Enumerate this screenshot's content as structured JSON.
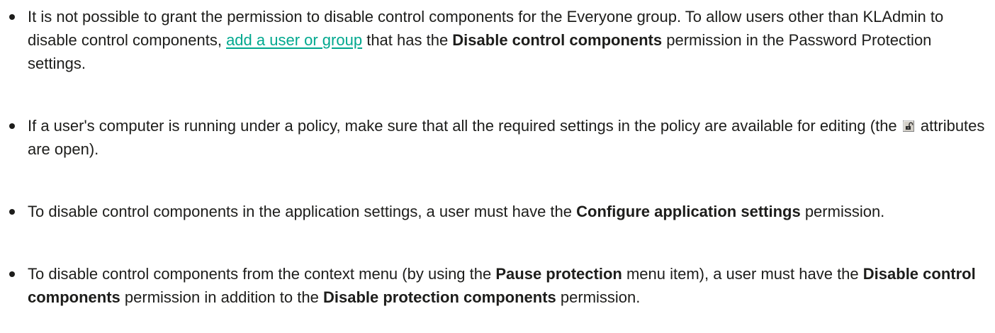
{
  "notes": [
    {
      "segments": [
        {
          "t": "It is not possible to grant the permission to disable control components for the Everyone group. To allow users other than KLAdmin to disable control components, "
        },
        {
          "t": "add a user or group",
          "link": true
        },
        {
          "t": " that has the "
        },
        {
          "t": "Disable control components",
          "bold": true
        },
        {
          "t": " permission in the Password Protection settings."
        }
      ]
    },
    {
      "segments": [
        {
          "t": "If a user's computer is running under a policy, make sure that all the required settings in the policy are available for editing (the "
        },
        {
          "icon": "open-lock-icon"
        },
        {
          "t": " attributes are open)."
        }
      ]
    },
    {
      "segments": [
        {
          "t": "To disable control components in the application settings, a user must have the "
        },
        {
          "t": "Configure application settings",
          "bold": true
        },
        {
          "t": " permission."
        }
      ]
    },
    {
      "segments": [
        {
          "t": "To disable control components from the context menu (by using the "
        },
        {
          "t": "Pause protection",
          "bold": true
        },
        {
          "t": " menu item), a user must have the "
        },
        {
          "t": "Disable control components",
          "bold": true
        },
        {
          "t": " permission in addition to the "
        },
        {
          "t": "Disable protection components",
          "bold": true
        },
        {
          "t": " permission."
        }
      ]
    }
  ],
  "colors": {
    "text": "#1d1d1b",
    "link": "#00a88e"
  }
}
